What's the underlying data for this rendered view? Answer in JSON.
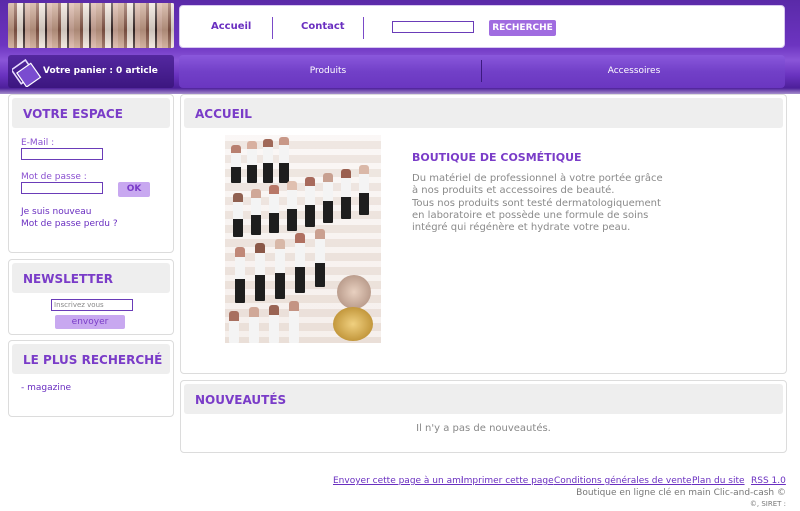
{
  "header": {
    "nav": [
      "Accueil",
      "Contact"
    ],
    "search_placeholder": "",
    "search_button": "RECHERCHE",
    "cart_label": "Votre panier : 0 article",
    "categories": [
      "Produits",
      "Accessoires"
    ]
  },
  "sidebar": {
    "espace": {
      "title": "VOTRE ESPACE",
      "email_label": "E-Mail :",
      "password_label": "Mot de passe :",
      "ok": "OK",
      "new_link": "Je suis nouveau",
      "lost_link": "Mot de passe perdu ?"
    },
    "newsletter": {
      "title": "NEWSLETTER",
      "input_value": "Inscrivez vous",
      "button": "envoyer"
    },
    "popular": {
      "title": "LE PLUS RECHERCHÉ",
      "items": [
        "- magazine"
      ]
    }
  },
  "main": {
    "accueil": {
      "title": "ACCUEIL",
      "heading": "BOUTIQUE DE COSMÉTIQUE",
      "paragraph_lines": [
        "Du matériel de professionnel à votre portée grâce",
        "à nos produits et accessoires de beauté.",
        "Tous nos produits sont testé dermatologiquement",
        "en laboratoire et possède une formule de soins",
        "intégré qui régénère et hydrate votre peau."
      ]
    },
    "nouveautes": {
      "title": "NOUVEAUTÉS",
      "empty": "Il n'y a pas de nouveautés."
    }
  },
  "footer": {
    "links": [
      "Envoyer cette page à un ami",
      "Imprimer cette page",
      "Conditions générales de vente",
      "Plan du site",
      "RSS 1.0"
    ],
    "line1": "Boutique en ligne clé en main Clic-and-cash ©",
    "line2": "©, SIRET :"
  },
  "colors": {
    "accent": "#7a3cc8",
    "band": "#6c34c0"
  }
}
